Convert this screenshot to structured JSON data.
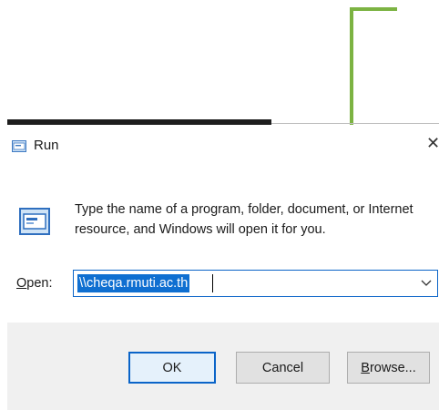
{
  "dialog": {
    "title": "Run",
    "close_glyph": "✕",
    "description": "Type the name of a program, folder, document, or Internet resource, and Windows will open it for you.",
    "open_label_accel": "O",
    "open_label_rest": "pen:",
    "input_value": "\\\\cheqa.rmuti.ac.th",
    "buttons": {
      "ok": "OK",
      "cancel": "Cancel",
      "browse_accel": "B",
      "browse_rest": "rowse..."
    }
  },
  "icons": {
    "title": "run-icon",
    "body": "run-icon",
    "dropdown": "chevron-down-icon"
  },
  "colors": {
    "annotation_arrow": "#7cb342",
    "accent": "#0f6fd1",
    "footer_bg": "#f0f0f0"
  }
}
